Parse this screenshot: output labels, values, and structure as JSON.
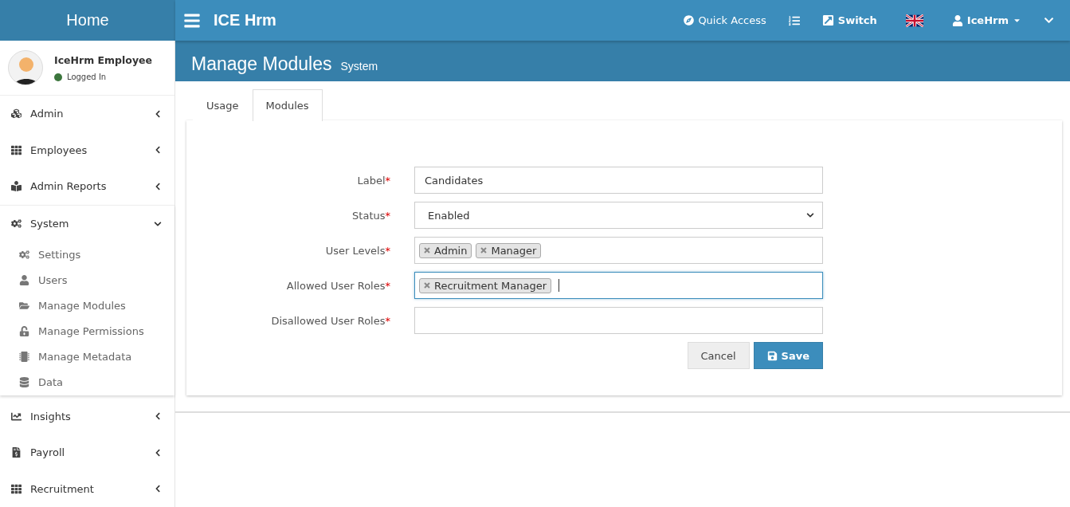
{
  "brand": "Home",
  "topbar": {
    "app_title": "ICE Hrm",
    "quick_access": "Quick Access",
    "switch": "Switch",
    "user": "IceHrm"
  },
  "user_panel": {
    "name": "IceHrm Employee",
    "status": "Logged In",
    "online": true
  },
  "sidebar": {
    "items": [
      {
        "label": "Admin",
        "expanded": false
      },
      {
        "label": "Employees",
        "expanded": false
      },
      {
        "label": "Admin Reports",
        "expanded": false
      },
      {
        "label": "System",
        "expanded": true,
        "children": [
          {
            "label": "Settings"
          },
          {
            "label": "Users"
          },
          {
            "label": "Manage Modules"
          },
          {
            "label": "Manage Permissions"
          },
          {
            "label": "Manage Metadata"
          },
          {
            "label": "Data"
          }
        ]
      },
      {
        "label": "Insights",
        "expanded": false
      },
      {
        "label": "Payroll",
        "expanded": false
      },
      {
        "label": "Recruitment",
        "expanded": false
      }
    ]
  },
  "page": {
    "title": "Manage Modules",
    "subtitle": "System"
  },
  "tabs": [
    {
      "label": "Usage",
      "selected": false
    },
    {
      "label": "Modules",
      "selected": true
    }
  ],
  "form": {
    "fields": [
      {
        "kind": "text",
        "label": "Label",
        "required_mark": "*",
        "value": "Candidates",
        "focused": false
      },
      {
        "kind": "select",
        "label": "Status",
        "required_mark": "*",
        "value": "Enabled",
        "focused": false
      },
      {
        "kind": "tags",
        "label": "User Levels",
        "required_mark": "*",
        "tags": [
          "Admin",
          "Manager"
        ],
        "focused": false
      },
      {
        "kind": "tags",
        "label": "Allowed User Roles",
        "required_mark": "*",
        "tags": [
          "Recruitment Manager"
        ],
        "focused": true
      },
      {
        "kind": "tags",
        "label": "Disallowed User Roles",
        "required_mark": "*",
        "focused": false
      }
    ],
    "buttons": {
      "cancel": "Cancel",
      "save": "Save"
    }
  }
}
